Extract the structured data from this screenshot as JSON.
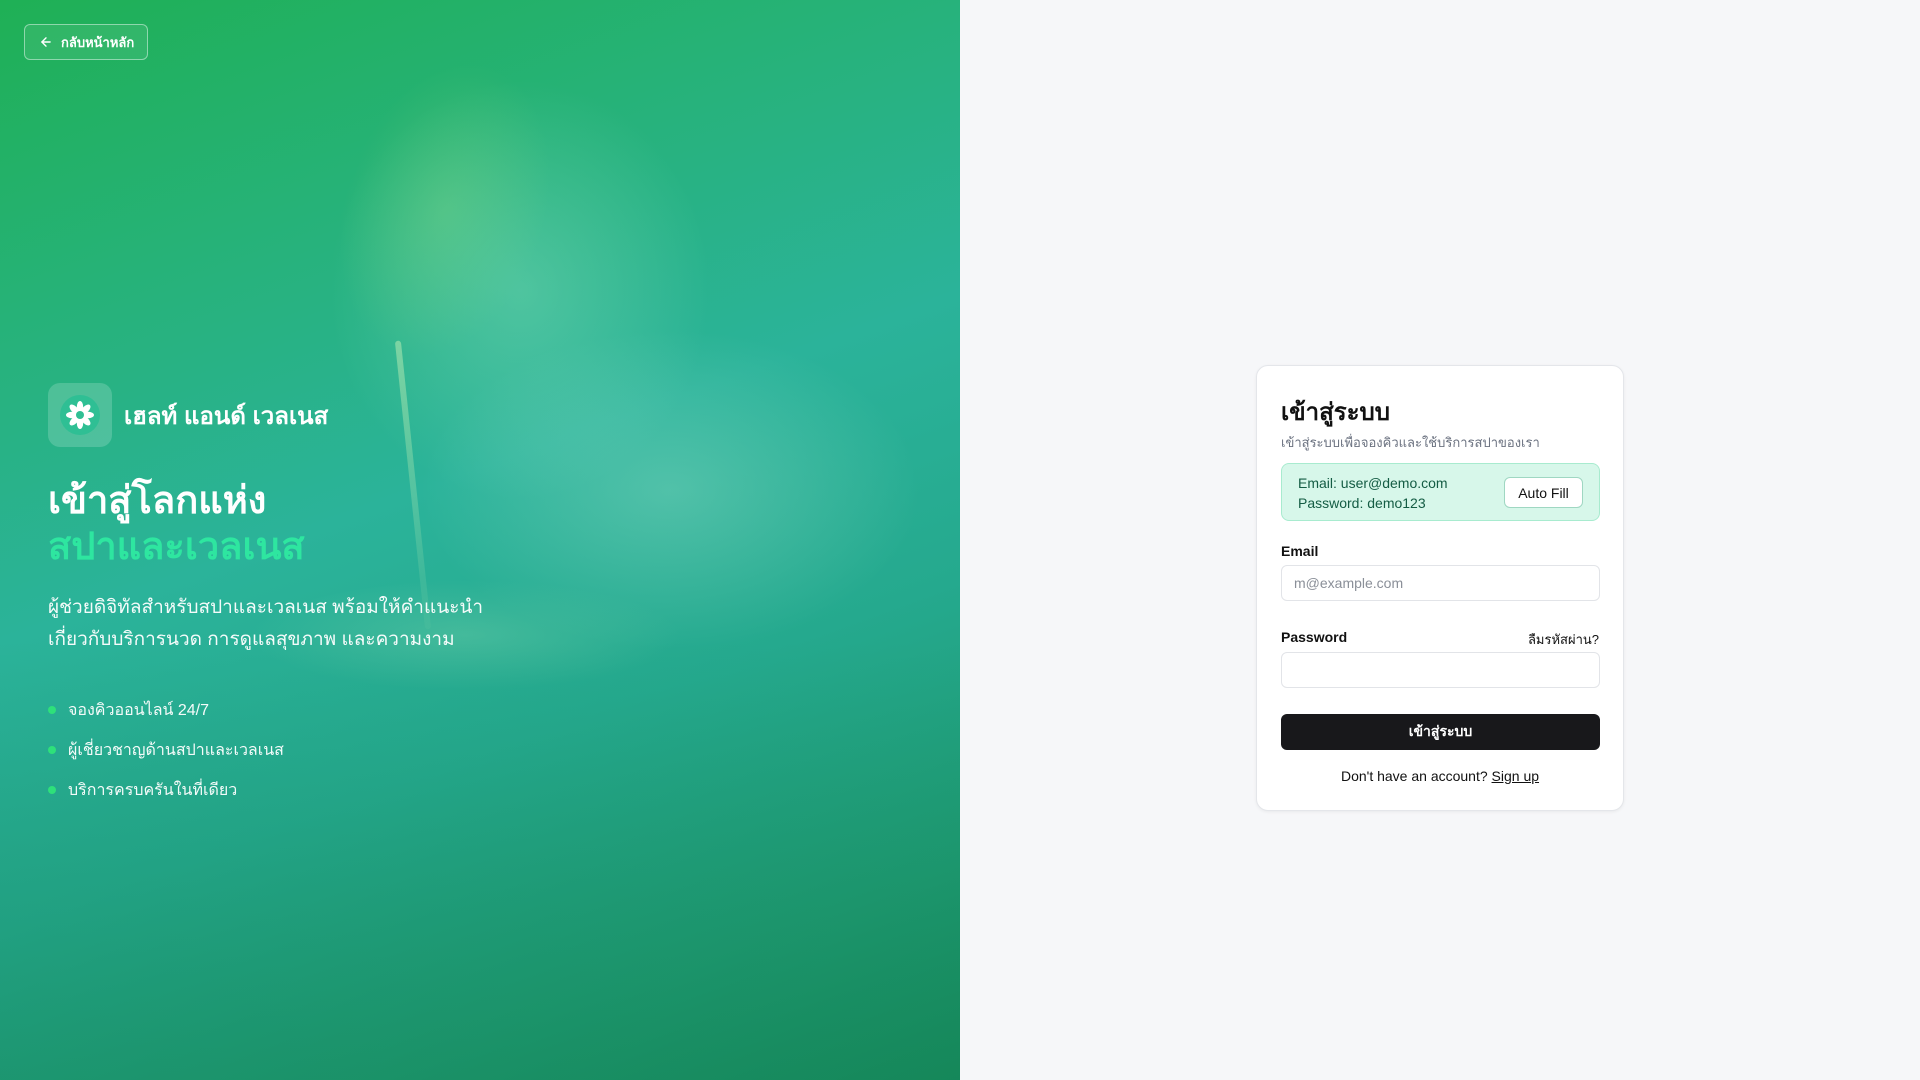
{
  "back_button": {
    "label": "กลับหน้าหลัก"
  },
  "brand": {
    "name": "เฮลท์ แอนด์ เวลเนส",
    "logo_icon": "flower-icon"
  },
  "hero": {
    "headline_line1": "เข้าสู่โลกแห่ง",
    "headline_line2": "สปาและเวลเนส",
    "description": "ผู้ช่วยดิจิทัลสำหรับสปาและเวลเนส พร้อมให้คำแนะนำเกี่ยวกับบริการนวด การดูแลสุขภาพ และความงาม",
    "features": [
      {
        "label": "จองคิวออนไลน์ 24/7"
      },
      {
        "label": "ผู้เชี่ยวชาญด้านสปาและเวลเนส"
      },
      {
        "label": "บริการครบครันในที่เดียว"
      }
    ]
  },
  "login": {
    "title": "เข้าสู่ระบบ",
    "subtitle": "เข้าสู่ระบบเพื่อจองคิวและใช้บริการสปาของเรา",
    "demo": {
      "email_text": "Email: user@demo.com",
      "password_text": "Password: demo123",
      "autofill_label": "Auto Fill"
    },
    "email_label": "Email",
    "email_placeholder": "m@example.com",
    "email_value": "",
    "password_label": "Password",
    "password_value": "",
    "forgot_label": "ลืมรหัสผ่าน?",
    "submit_label": "เข้าสู่ระบบ",
    "signup_prompt": "Don't have an account?",
    "signup_link": "Sign up"
  },
  "colors": {
    "accent_green": "#2ee6a0",
    "feature_dot": "#2ee07a",
    "primary_button": "#18181b",
    "demo_box_bg": "#d7f7ea"
  }
}
